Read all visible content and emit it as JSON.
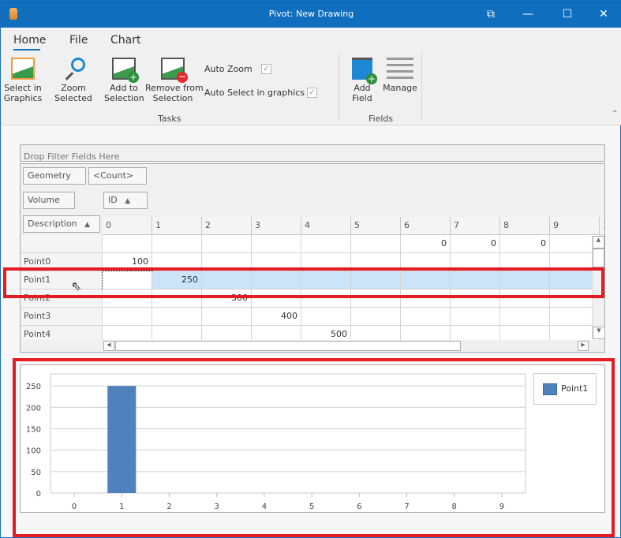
{
  "window": {
    "title": "Pivot: New Drawing",
    "controls": [
      "restore-down",
      "minimize",
      "maximize",
      "close"
    ]
  },
  "ribbon": {
    "tabs": [
      {
        "label": "Home",
        "active": true
      },
      {
        "label": "File"
      },
      {
        "label": "Chart"
      }
    ],
    "tasks": {
      "group_label": "Tasks",
      "buttons": [
        {
          "label": "Select in\nGraphics",
          "icon": "select-picture-icon"
        },
        {
          "label": "Zoom Selected",
          "icon": "magnifier-icon"
        },
        {
          "label": "Add to\nSelection",
          "icon": "add-picture-icon"
        },
        {
          "label": "Remove from\nSelection",
          "icon": "remove-picture-icon"
        }
      ],
      "auto_zoom": {
        "label": "Auto Zoom",
        "checked": true
      },
      "auto_select": {
        "label": "Auto Select in graphics",
        "checked": true
      }
    },
    "fields": {
      "group_label": "Fields",
      "buttons": [
        {
          "label": "Add Field",
          "icon": "add-field-icon"
        },
        {
          "label": "Manage",
          "icon": "manage-list-icon"
        }
      ]
    }
  },
  "pivot": {
    "filter_placeholder": "Drop Filter Fields Here",
    "data_fields": [
      "Geometry",
      "<Count>"
    ],
    "extra_field": "Volume",
    "column_field": "ID",
    "row_field": "Description",
    "columns": [
      "0",
      "1",
      "2",
      "3",
      "4",
      "5",
      "6",
      "7",
      "8",
      "9",
      "1"
    ],
    "rows": [
      {
        "label": "",
        "values": [
          "",
          "",
          "",
          "",
          "",
          "",
          "0",
          "0",
          "0",
          ""
        ]
      },
      {
        "label": "Point0",
        "values": [
          "100",
          "",
          "",
          "",
          "",
          "",
          "",
          "",
          "",
          ""
        ]
      },
      {
        "label": "Point1",
        "values": [
          "",
          "250",
          "",
          "",
          "",
          "",
          "",
          "",
          "",
          ""
        ],
        "selected": true
      },
      {
        "label": "Point2",
        "values": [
          "",
          "",
          "300",
          "",
          "",
          "",
          "",
          "",
          "",
          ""
        ]
      },
      {
        "label": "Point3",
        "values": [
          "",
          "",
          "",
          "400",
          "",
          "",
          "",
          "",
          "",
          ""
        ]
      },
      {
        "label": "Point4",
        "values": [
          "",
          "",
          "",
          "",
          "500",
          "",
          "",
          "",
          "",
          ""
        ]
      }
    ]
  },
  "chart_data": {
    "type": "bar",
    "categories": [
      "0",
      "1",
      "2",
      "3",
      "4",
      "5",
      "6",
      "7",
      "8",
      "9"
    ],
    "series": [
      {
        "name": "Point1",
        "values": [
          0,
          250,
          0,
          0,
          0,
          0,
          0,
          0,
          0,
          0
        ],
        "color": "#4f81bd"
      }
    ],
    "yticks": [
      0,
      50,
      100,
      150,
      200,
      250
    ],
    "ylim": [
      0,
      278
    ],
    "grid": true,
    "legend": "right"
  },
  "colors": {
    "titlebar": "#106ebe",
    "highlight": "#e31b23",
    "selection": "#cce4f7"
  }
}
